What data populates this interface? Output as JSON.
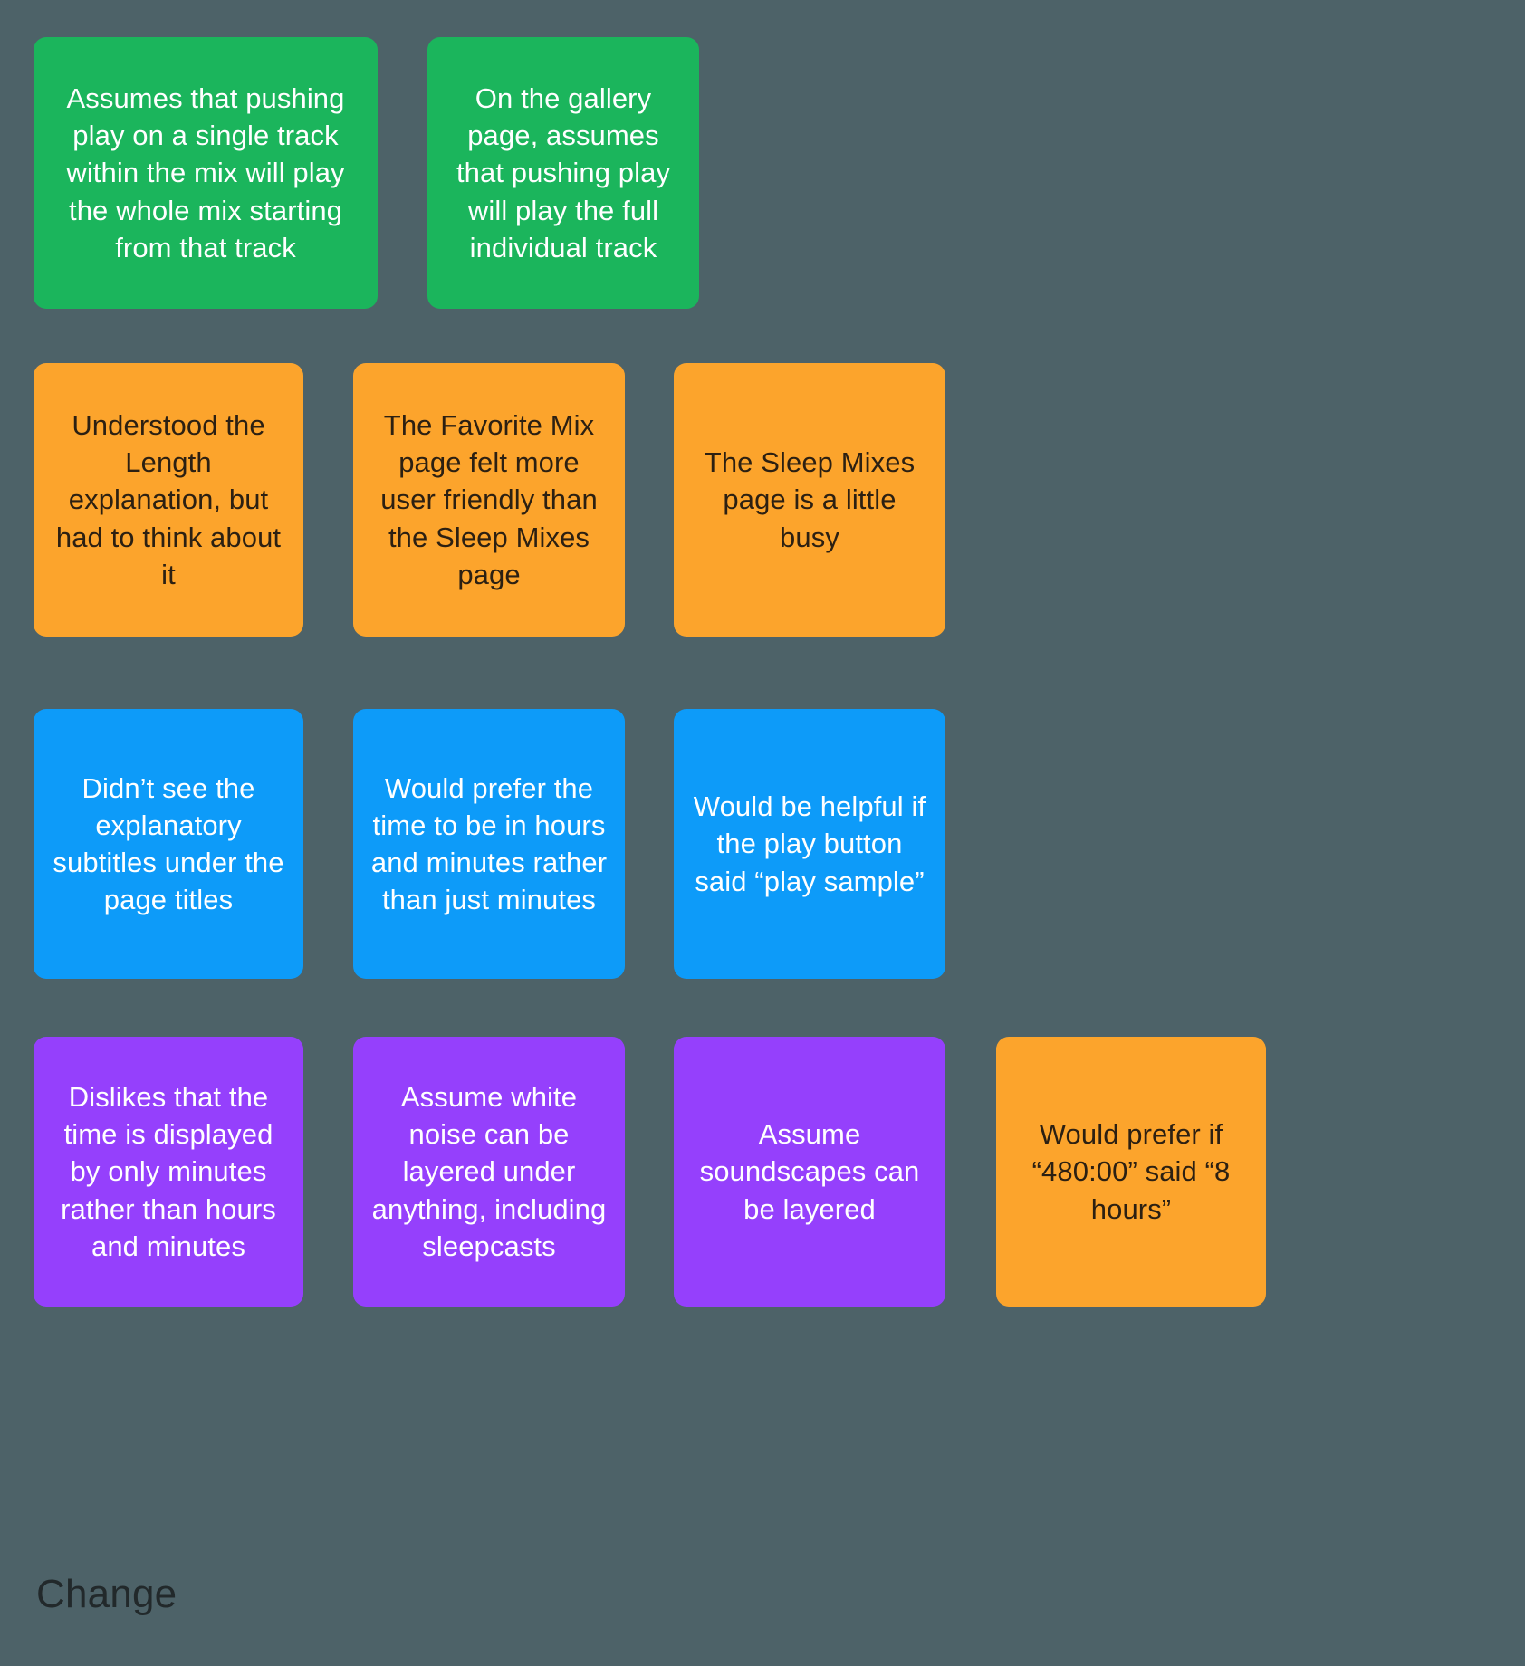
{
  "canvas": {
    "background_color": "#4d6268",
    "section_caption": "Change"
  },
  "palette": {
    "green": "#1bb55c",
    "orange": "#fca42c",
    "blue": "#0d9bf9",
    "purple": "#9540fc",
    "background": "#4d6268",
    "caption_text": "#22292b"
  },
  "notes": {
    "row1": [
      {
        "color": "green",
        "text": "Assumes that pushing play on a single track within the mix will play the whole mix starting from that track"
      },
      {
        "color": "green",
        "text": "On the gallery page, assumes that pushing play will play the full individual track"
      }
    ],
    "row2": [
      {
        "color": "orange",
        "text": "Understood the Length explanation, but had to think about it"
      },
      {
        "color": "orange",
        "text": "The Favorite Mix page felt more user friendly than the Sleep Mixes page"
      },
      {
        "color": "orange",
        "text": "The Sleep Mixes page is a little busy"
      }
    ],
    "row3": [
      {
        "color": "blue",
        "text": "Didn’t see the explanatory subtitles under the page titles"
      },
      {
        "color": "blue",
        "text": "Would prefer the time to be in hours and minutes rather than just minutes"
      },
      {
        "color": "blue",
        "text": "Would be helpful if the play button said “play sample”"
      }
    ],
    "row4": [
      {
        "color": "purple",
        "text": "Dislikes that the time is displayed by only minutes rather than hours and minutes"
      },
      {
        "color": "purple",
        "text": "Assume white noise can be layered under anything, including sleepcasts"
      },
      {
        "color": "purple",
        "text": "Assume soundscapes can be layered"
      },
      {
        "color": "orange",
        "text": "Would prefer if “480:00” said “8 hours”"
      }
    ]
  }
}
